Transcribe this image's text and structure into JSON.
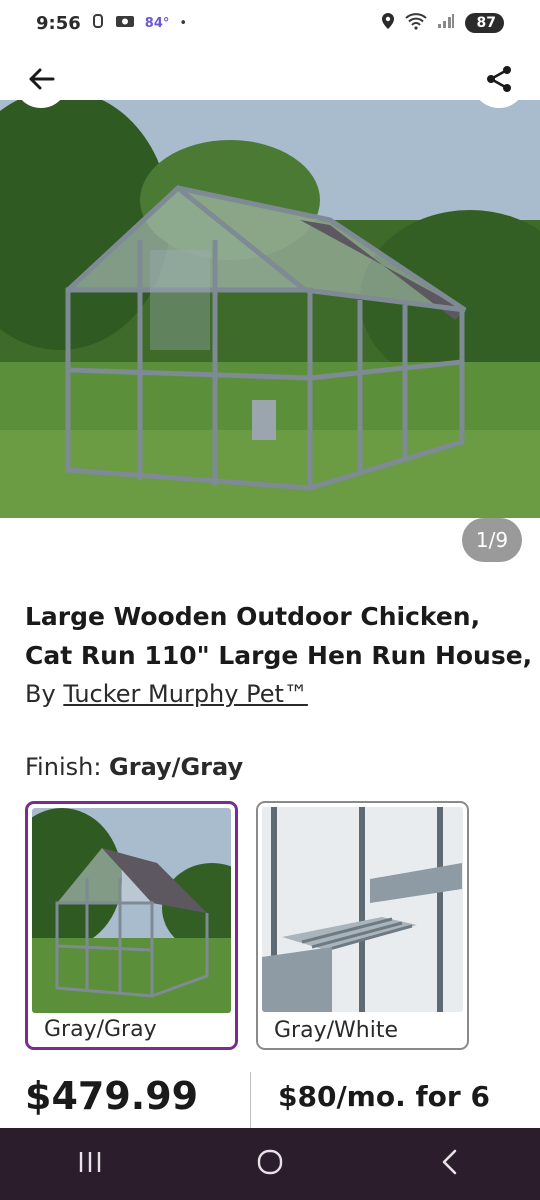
{
  "status_bar": {
    "time": "9:56",
    "temperature": "84°",
    "signal_note": "5",
    "battery": "87"
  },
  "header": {
    "back_icon": "arrow-left-icon",
    "share_icon": "share-icon"
  },
  "gallery": {
    "counter": "1/9"
  },
  "product": {
    "title_line1": "Large Wooden Outdoor Chicken,",
    "title_line2": "Cat Run 110\" Large Hen Run House,",
    "by_label": "By",
    "brand": "Tucker Murphy Pet™"
  },
  "finish": {
    "label": "Finish:",
    "selected": "Gray/Gray",
    "options": [
      {
        "label": "Gray/Gray",
        "selected": true
      },
      {
        "label": "Gray/White",
        "selected": false
      }
    ]
  },
  "pricing": {
    "price": "$479.99",
    "financing": "$80/mo. for 6"
  },
  "nav": {
    "recents_icon": "recents-icon",
    "home_icon": "home-icon",
    "back_icon": "back-chevron-icon"
  },
  "colors": {
    "accent": "#7b2c8f",
    "nav_bg": "#2b1d2c"
  }
}
